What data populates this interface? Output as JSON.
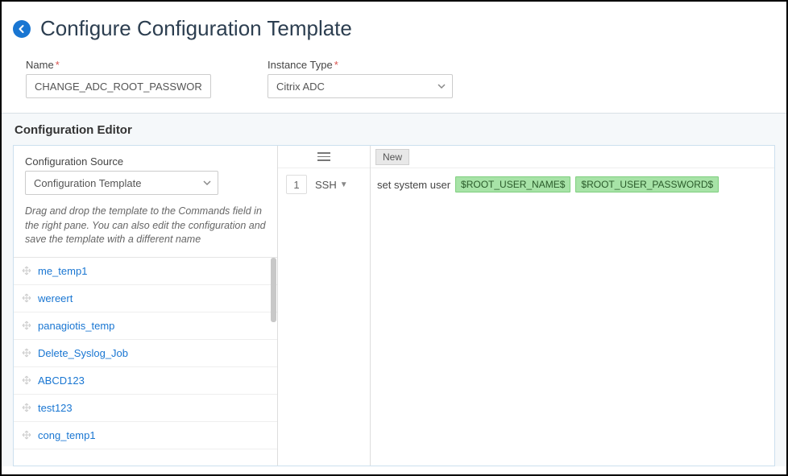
{
  "page_title": "Configure Configuration Template",
  "form": {
    "name_label": "Name",
    "name_value": "CHANGE_ADC_ROOT_PASSWORD",
    "instance_type_label": "Instance Type",
    "instance_type_value": "Citrix ADC"
  },
  "editor": {
    "title": "Configuration Editor",
    "config_source_label": "Configuration Source",
    "config_source_value": "Configuration Template",
    "hint": "Drag and drop the template to the Commands field in the right pane. You can also edit the configuration and save the template with a different name",
    "templates": [
      "me_temp1",
      "wereert",
      "panagiotis_temp",
      "Delete_Syslog_Job",
      "ABCD123",
      "test123",
      "cong_temp1"
    ],
    "line_number": "1",
    "protocol": "SSH",
    "new_badge": "New",
    "command_prefix": "set system user",
    "vars": [
      "$ROOT_USER_NAME$",
      "$ROOT_USER_PASSWORD$"
    ]
  }
}
